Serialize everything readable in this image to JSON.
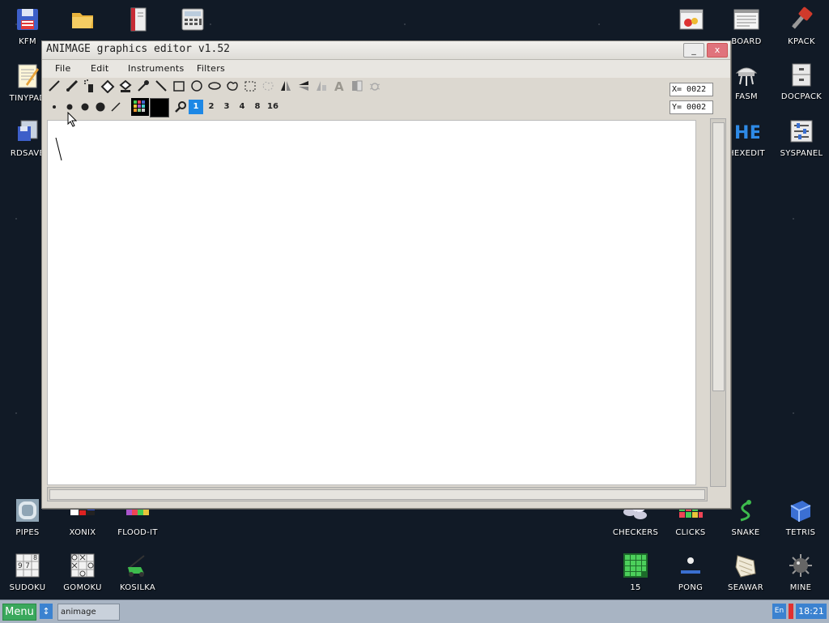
{
  "desktop": {
    "icons": [
      {
        "label": "KFM",
        "icon": "floppy-disk-icon"
      },
      {
        "label": "",
        "icon": "folder-icon"
      },
      {
        "label": "",
        "icon": "book-icon"
      },
      {
        "label": "",
        "icon": "calculator-icon"
      },
      {
        "label": "TINYPAD",
        "icon": "notepad-icon"
      },
      {
        "label": "RDSAVE",
        "icon": "rdsave-icon"
      },
      {
        "label": "",
        "icon": "system-info-icon"
      },
      {
        "label": "BOARD",
        "icon": "board-icon"
      },
      {
        "label": "KPACK",
        "icon": "kpack-icon"
      },
      {
        "label": "FASM",
        "icon": "fasm-icon"
      },
      {
        "label": "DOCPACK",
        "icon": "docpack-icon"
      },
      {
        "label": "HEXEDIT",
        "icon": "hexedit-icon"
      },
      {
        "label": "SYSPANEL",
        "icon": "syspanel-icon"
      },
      {
        "label": "PIPES",
        "icon": "pipes-icon"
      },
      {
        "label": "XONIX",
        "icon": "xonix-icon"
      },
      {
        "label": "FLOOD-IT",
        "icon": "flood-it-icon"
      },
      {
        "label": "CHECKERS",
        "icon": "checkers-icon"
      },
      {
        "label": "CLICKS",
        "icon": "clicks-icon"
      },
      {
        "label": "SNAKE",
        "icon": "snake-icon"
      },
      {
        "label": "TETRIS",
        "icon": "tetris-icon"
      },
      {
        "label": "SUDOKU",
        "icon": "sudoku-icon"
      },
      {
        "label": "GOMOKU",
        "icon": "gomoku-icon"
      },
      {
        "label": "KOSILKA",
        "icon": "lawnmower-icon"
      },
      {
        "label": "15",
        "icon": "fifteen-puzzle-icon"
      },
      {
        "label": "PONG",
        "icon": "pong-icon"
      },
      {
        "label": "SEAWAR",
        "icon": "seawar-icon"
      },
      {
        "label": "MINE",
        "icon": "mine-icon"
      }
    ]
  },
  "window": {
    "title": "ANIMAGE graphics editor v1.52",
    "minimize_glyph": "_",
    "close_glyph": "x",
    "menu": [
      "File",
      "Edit",
      "Instruments",
      "Filters"
    ],
    "tools": [
      "pencil-icon",
      "brush-icon",
      "spray-icon",
      "eraser-icon",
      "fill-icon",
      "pipette-icon",
      "line-icon",
      "rectangle-icon",
      "circle-icon",
      "ellipse-icon",
      "free-shape-icon",
      "selection-icon",
      "lasso-icon",
      "flip-vertical-icon",
      "flip-horizontal-icon",
      "rotate-icon",
      "text-icon",
      "gradient-icon",
      "bug-icon"
    ],
    "brush_sizes": [
      "1",
      "2",
      "3",
      "4",
      "8",
      "16"
    ],
    "active_size": "1",
    "coord_x": "X= 0022",
    "coord_y": "Y= 0002",
    "colors": {
      "primary": "#000000",
      "accent": "#1e88e5"
    }
  },
  "taskbar": {
    "menu_label": "Menu",
    "swap_glyph": "↕",
    "task_label": "animage",
    "lang": "En",
    "clock": "18:21"
  }
}
